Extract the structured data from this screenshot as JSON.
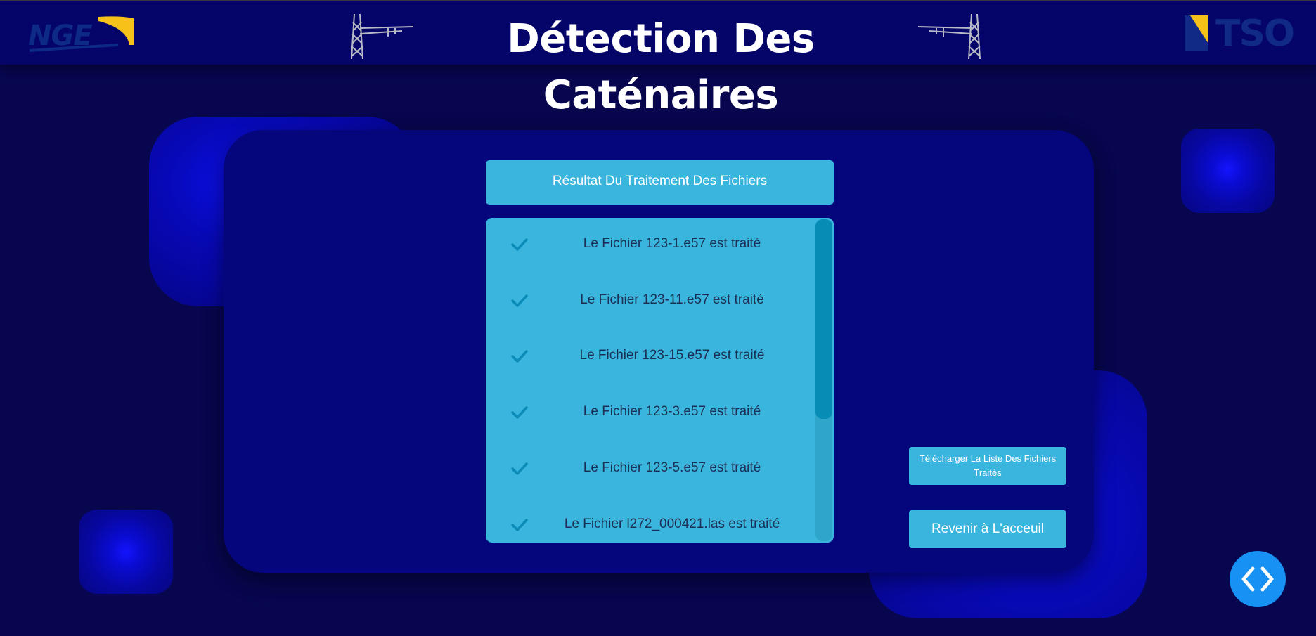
{
  "header": {
    "title": "Détection Des Caténaires",
    "logo_left_text": "NGE",
    "logo_right_text": "TSO"
  },
  "results": {
    "title": "Résultat Du Traitement Des Fichiers",
    "files": [
      {
        "label": "Le Fichier 123-1.e57 est traité",
        "icon": "check-icon"
      },
      {
        "label": "Le Fichier 123-11.e57 est traité",
        "icon": "check-icon"
      },
      {
        "label": "Le Fichier 123-15.e57 est traité",
        "icon": "check-icon"
      },
      {
        "label": "Le Fichier 123-3.e57 est traité",
        "icon": "check-icon"
      },
      {
        "label": "Le Fichier 123-5.e57 est traité",
        "icon": "check-icon"
      },
      {
        "label": "Le Fichier l272_000421.las est traité",
        "icon": "check-icon"
      }
    ]
  },
  "actions": {
    "download_label": "Télécharger La Liste Des Fichiers Traités",
    "home_label": "Revenir à L'acceuil"
  },
  "floating_button": {
    "icon": "code-icon"
  },
  "colors": {
    "background": "#07064e",
    "header": "#050468",
    "card": "#05057c",
    "accent": "#3ab6de",
    "check": "#0b8cb8",
    "fab": "#1791f4",
    "logo_yellow": "#f6c21a"
  }
}
